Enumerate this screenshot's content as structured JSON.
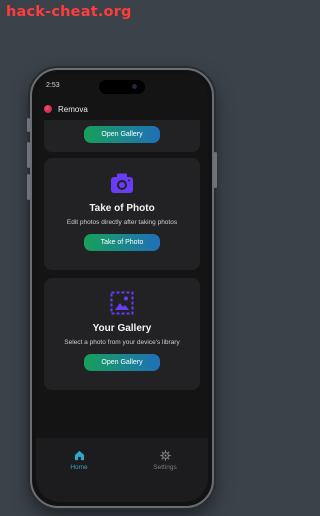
{
  "watermark": "hack-cheat.org",
  "status_bar": {
    "time": "2:53"
  },
  "app": {
    "title": "Remova"
  },
  "cards": {
    "top": {
      "button": "Open Gallery"
    },
    "photo": {
      "icon": "camera-icon",
      "title": "Take of Photo",
      "subtitle": "Edit photos directly after taking photos",
      "button": "Take of Photo"
    },
    "gallery": {
      "icon": "gallery-icon",
      "title": "Your Gallery",
      "subtitle": "Select a photo from your device's library",
      "button": "Open Gallery"
    }
  },
  "nav": {
    "items": [
      {
        "label": "Home",
        "icon": "home-icon",
        "active": true
      },
      {
        "label": "Settings",
        "icon": "gear-icon",
        "active": false
      }
    ]
  },
  "colors": {
    "background": "#3b4249",
    "accent_purple": "#6a3cf5",
    "accent_teal": "#2ea7c9",
    "button_gradient_start": "#17a05a",
    "button_gradient_end": "#1f6fb8",
    "watermark": "#ff3d3d"
  }
}
